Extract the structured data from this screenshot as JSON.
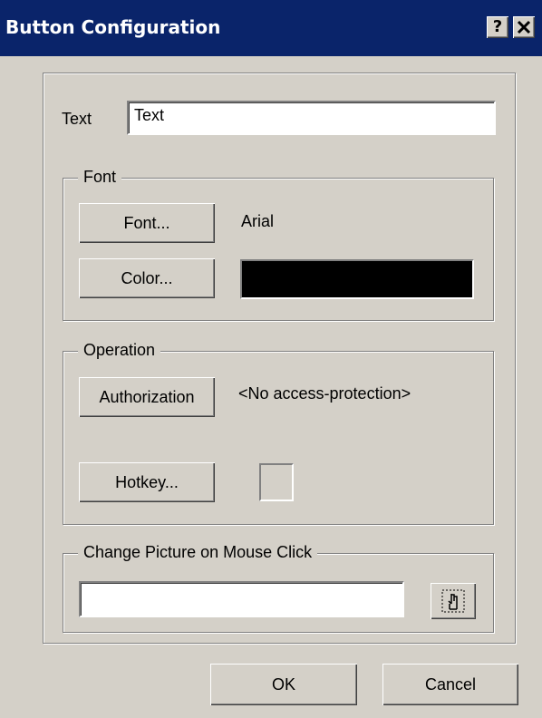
{
  "window": {
    "title": "Button Configuration",
    "help_label": "?",
    "close_label": "✕"
  },
  "text_field": {
    "label": "Text",
    "value": "Text"
  },
  "font_group": {
    "title": "Font",
    "font_button": "Font...",
    "font_value": "Arial",
    "color_button": "Color...",
    "color_value": "#000000"
  },
  "operation_group": {
    "title": "Operation",
    "authorization_button": "Authorization",
    "authorization_value": "<No access-protection>",
    "hotkey_button": "Hotkey..."
  },
  "picture_group": {
    "title": "Change Picture on Mouse Click",
    "value": "",
    "browse_icon": "cursor-pointer-icon"
  },
  "footer": {
    "ok_label": "OK",
    "cancel_label": "Cancel"
  }
}
